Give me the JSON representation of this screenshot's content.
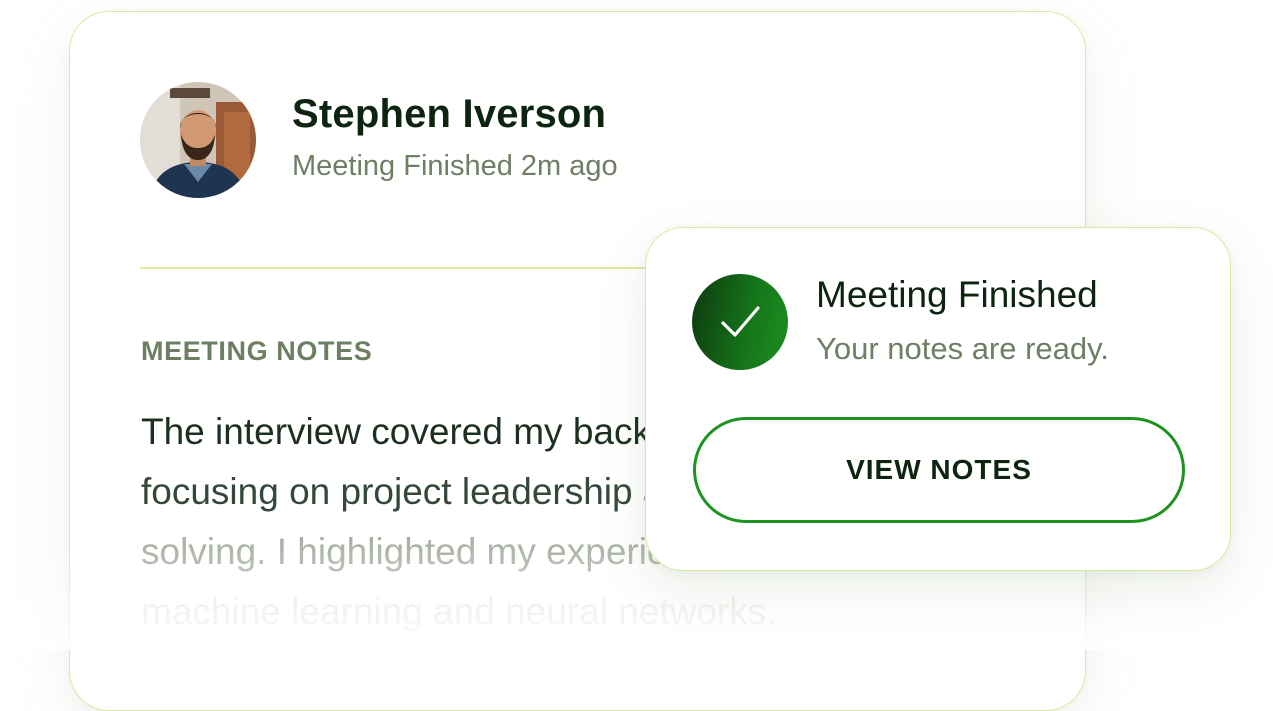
{
  "profile": {
    "name": "Stephen Iverson",
    "status": "Meeting Finished 2m ago"
  },
  "notes": {
    "label": "MEETING NOTES",
    "lines": [
      "The interview covered my background,",
      "focusing on project leadership and problem-",
      "solving. I highlighted my experience with",
      "machine learning and neural networks."
    ]
  },
  "notification": {
    "title": "Meeting Finished",
    "subtitle": "Your notes are ready.",
    "button_label": "VIEW NOTES",
    "icon": "check-icon"
  },
  "colors": {
    "primary_green": "#1e9420",
    "dark_text": "#0c2410",
    "muted_text": "#6f7f66",
    "border_lime": "#d7eaa0"
  }
}
